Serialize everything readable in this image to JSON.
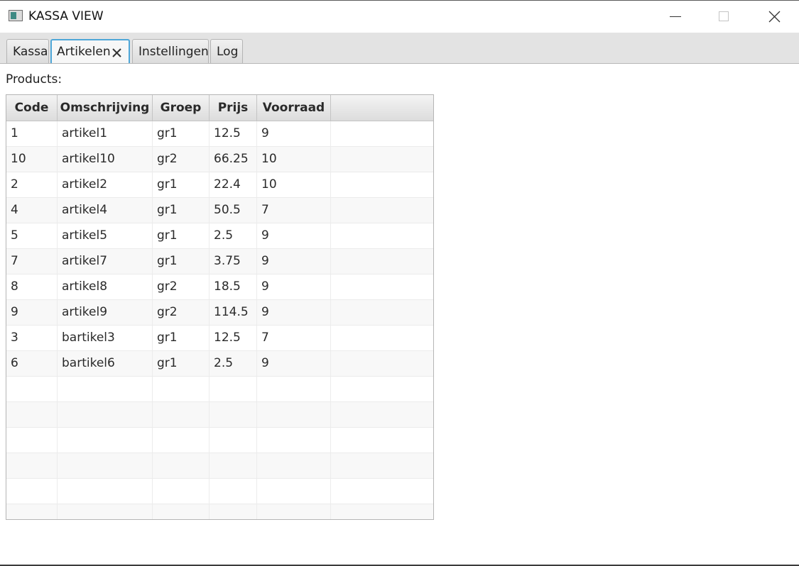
{
  "window": {
    "title": "KASSA VIEW",
    "app_icon": "app-window-icon",
    "controls": [
      "minimize-icon",
      "maximize-icon",
      "close-icon"
    ]
  },
  "tabs": [
    {
      "label": "Kassa",
      "active": false,
      "closable": false
    },
    {
      "label": "Artikelen",
      "active": true,
      "closable": true
    },
    {
      "label": "Instellingen",
      "active": false,
      "closable": false
    },
    {
      "label": "Log",
      "active": false,
      "closable": false
    }
  ],
  "products": {
    "label": "Products:",
    "columns": [
      "Code",
      "Omschrijving",
      "Groep",
      "Prijs",
      "Voorraad"
    ],
    "rows": [
      [
        "1",
        "artikel1",
        "gr1",
        "12.5",
        "9"
      ],
      [
        "10",
        "artikel10",
        "gr2",
        "66.25",
        "10"
      ],
      [
        "2",
        "artikel2",
        "gr1",
        "22.4",
        "10"
      ],
      [
        "4",
        "artikel4",
        "gr1",
        "50.5",
        "7"
      ],
      [
        "5",
        "artikel5",
        "gr1",
        "2.5",
        "9"
      ],
      [
        "7",
        "artikel7",
        "gr1",
        "3.75",
        "9"
      ],
      [
        "8",
        "artikel8",
        "gr2",
        "18.5",
        "9"
      ],
      [
        "9",
        "artikel9",
        "gr2",
        "114.5",
        "9"
      ],
      [
        "3",
        "bartikel3",
        "gr1",
        "12.5",
        "7"
      ],
      [
        "6",
        "bartikel6",
        "gr1",
        "2.5",
        "9"
      ]
    ]
  },
  "colors": {
    "active_tab_border": "#4fa7d8",
    "tabbar_background": "#e3e3e3",
    "header_gradient_top": "#f4f4f4",
    "header_gradient_bottom": "#dcdcdc",
    "alternate_row": "#f8f8f8"
  }
}
